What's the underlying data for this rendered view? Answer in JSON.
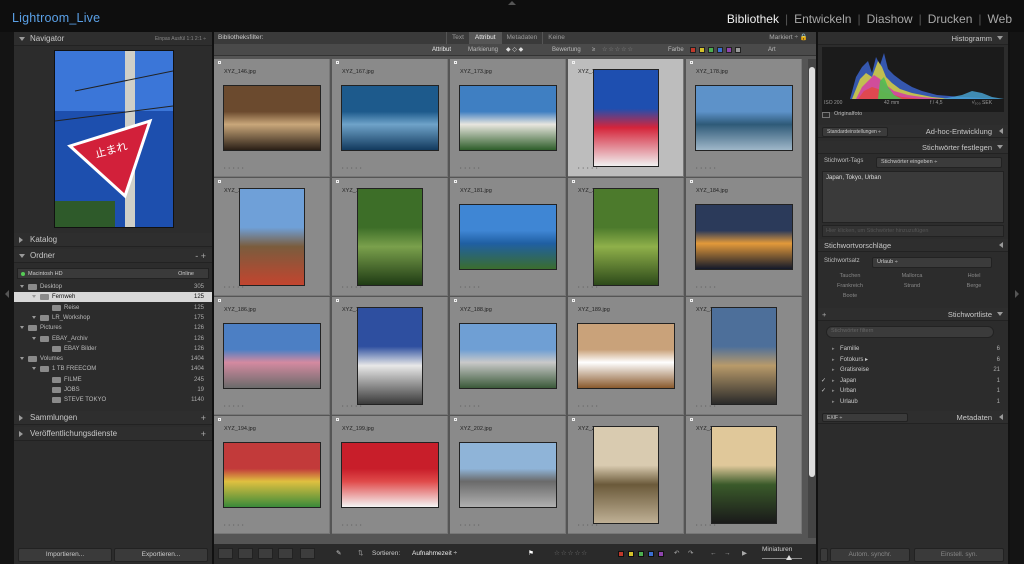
{
  "app": {
    "title": "Lightroom_Live",
    "modules": [
      {
        "label": "Bibliothek",
        "active": true
      },
      {
        "label": "Entwickeln",
        "active": false
      },
      {
        "label": "Diashow",
        "active": false
      },
      {
        "label": "Drucken",
        "active": false
      },
      {
        "label": "Web",
        "active": false
      }
    ]
  },
  "left_panel": {
    "navigator": {
      "title": "Navigator",
      "opts": "Einpas  Ausfül  1:1  2:1 ÷"
    },
    "catalog": {
      "title": "Katalog"
    },
    "folders": {
      "title": "Ordner",
      "plus": "-  +",
      "disk": {
        "name": "Macintosh HD",
        "status": "Online"
      },
      "rows": [
        {
          "name": "Desktop",
          "count": "305",
          "level": 1,
          "selected": false
        },
        {
          "name": "Fernweh",
          "count": "125",
          "level": 2,
          "selected": true
        },
        {
          "name": "Reise",
          "count": "125",
          "level": 3,
          "selected": false
        },
        {
          "name": "LR_Workshop",
          "count": "175",
          "level": 2,
          "selected": false
        },
        {
          "name": "Pictures",
          "count": "126",
          "level": 1,
          "selected": false
        },
        {
          "name": "EBAY_Archiv",
          "count": "126",
          "level": 2,
          "selected": false
        },
        {
          "name": "EBAY Bilder",
          "count": "126",
          "level": 3,
          "selected": false
        },
        {
          "name": "Volumes",
          "count": "1404",
          "level": 1,
          "selected": false
        },
        {
          "name": "1 TB FREECOM",
          "count": "1404",
          "level": 2,
          "selected": false
        },
        {
          "name": "FILME",
          "count": "245",
          "level": 3,
          "selected": false
        },
        {
          "name": "JOBS",
          "count": "19",
          "level": 3,
          "selected": false
        },
        {
          "name": "STEVE TOKYO",
          "count": "1140",
          "level": 3,
          "selected": false
        }
      ]
    },
    "collections": {
      "title": "Sammlungen",
      "plus": "+"
    },
    "publish": {
      "title": "Veröffentlichungsdienste",
      "plus": "+"
    },
    "import_label": "Importieren...",
    "export_label": "Exportieren..."
  },
  "filter_bar": {
    "title": "Bibliotheksfilter:",
    "tabs": [
      {
        "label": "Text",
        "active": false
      },
      {
        "label": "Attribut",
        "active": true
      },
      {
        "label": "Metadaten",
        "active": false
      },
      {
        "label": "Keine",
        "active": false
      }
    ],
    "preset": "Markiert ÷  🔒",
    "attr_label": "Attribut",
    "markierung": "Markierung",
    "bewertung": "Bewertung",
    "bewertung_op": "≥",
    "farbe": "Farbe",
    "art": "Art",
    "colors": [
      "#c0392b",
      "#d4c12a",
      "#4caf50",
      "#3b6fd0",
      "#8e44ad",
      "#999999"
    ]
  },
  "grid": {
    "cells": [
      {
        "file": "XYZ_146.jpg",
        "colors": [
          "#6b4a2e",
          "#c9a77a",
          "#2a1f16"
        ],
        "orient": "land"
      },
      {
        "file": "XYZ_167.jpg",
        "colors": [
          "#1d5a8c",
          "#6fa3c9",
          "#123a5e"
        ],
        "orient": "land"
      },
      {
        "file": "XYZ_173.jpg",
        "colors": [
          "#3f7fc2",
          "#e8e6df",
          "#2e5e2a"
        ],
        "orient": "land"
      },
      {
        "file": "XYZ_177.jpg",
        "colors": [
          "#1e4fb0",
          "#d5243a",
          "#f0f0f0"
        ],
        "orient": "port",
        "selected": true
      },
      {
        "file": "XYZ_178.jpg",
        "colors": [
          "#5d92c9",
          "#2e5a78",
          "#9fb7c9"
        ],
        "orient": "land"
      },
      {
        "file": "XYZ_179.jpg",
        "colors": [
          "#6fa0d8",
          "#7a5c3d",
          "#c3452f"
        ],
        "orient": "port"
      },
      {
        "file": "XYZ_180.jpg",
        "colors": [
          "#3d6e28",
          "#7aa04c",
          "#1f3b14"
        ],
        "orient": "port"
      },
      {
        "file": "XYZ_181.jpg",
        "colors": [
          "#3f86d4",
          "#1f5fa3",
          "#3b6d2e"
        ],
        "orient": "land"
      },
      {
        "file": "XYZ_183.jpg",
        "colors": [
          "#4c7a2c",
          "#8fb04a",
          "#2d4a1a"
        ],
        "orient": "port"
      },
      {
        "file": "XYZ_184.jpg",
        "colors": [
          "#2b3a5a",
          "#e39a3a",
          "#141a2a"
        ],
        "orient": "land"
      },
      {
        "file": "XYZ_186.jpg",
        "colors": [
          "#4c7fc4",
          "#d48aa0",
          "#6b6b6b"
        ],
        "orient": "land"
      },
      {
        "file": "XYZ_187.jpg",
        "colors": [
          "#2e4fa0",
          "#e8e8e8",
          "#3a3a3a"
        ],
        "orient": "port"
      },
      {
        "file": "XYZ_188.jpg",
        "colors": [
          "#6f9fd4",
          "#c9c9c9",
          "#3b5a3a"
        ],
        "orient": "land"
      },
      {
        "file": "XYZ_189.jpg",
        "colors": [
          "#c9a27a",
          "#ffffff",
          "#8a5a2e"
        ],
        "orient": "land"
      },
      {
        "file": "XYZ_191.jpg",
        "colors": [
          "#4d6f9a",
          "#b89a6a",
          "#2a2a2a"
        ],
        "orient": "port"
      },
      {
        "file": "XYZ_194.jpg",
        "colors": [
          "#c23a3a",
          "#e0c040",
          "#3a8a3a"
        ],
        "orient": "land"
      },
      {
        "file": "XYZ_199.jpg",
        "colors": [
          "#c81e2a",
          "#e04a4a",
          "#f5f5f5"
        ],
        "orient": "land"
      },
      {
        "file": "XYZ_202.jpg",
        "colors": [
          "#8fb4d8",
          "#6a6a6a",
          "#b0b0b0"
        ],
        "orient": "land"
      },
      {
        "file": "XYZ_205.jpg",
        "colors": [
          "#d9cbb0",
          "#6b5a3a",
          "#bfb095"
        ],
        "orient": "port"
      },
      {
        "file": "XYZ_213.jpg",
        "colors": [
          "#e0c89a",
          "#3a5a2a",
          "#1a1a1a"
        ],
        "orient": "port"
      }
    ],
    "stars": "• • • • •"
  },
  "toolbar": {
    "sort_label": "Sortieren:",
    "sort_value": "Aufnahmezeit ÷",
    "thumb_label": "Miniaturen",
    "tag_colors": [
      "#c0392b",
      "#d4c12a",
      "#4caf50",
      "#3b6fd0",
      "#8e44ad"
    ]
  },
  "right_panel": {
    "histogram": {
      "title": "Histogramm",
      "iso": "ISO 200",
      "focal": "42 mm",
      "aperture": "f / 4,5",
      "shutter": "¹⁄₅₀₀ SEK",
      "original": "Originalfoto"
    },
    "quick_develop": {
      "title": "Ad-hoc-Entwicklung",
      "preset": "Standardeinstellungen ÷"
    },
    "keywording": {
      "title": "Stichwörter festlegen",
      "tags_label": "Stichwort-Tags",
      "tags_select": "Stichwörter eingeben ÷",
      "tags_value": "Japan, Tokyo, Urban",
      "input_placeholder": "Hier klicken, um Stichwörter hinzuzufügen"
    },
    "suggestions": {
      "title": "Stichwortvorschläge"
    },
    "keyword_set": {
      "label": "Stichwortsatz",
      "value": "Urlaub ÷",
      "items": [
        "Tauchen",
        "Mallorca",
        "Hotel",
        "Frankreich",
        "Strand",
        "Berge",
        "Boote",
        "",
        ""
      ]
    },
    "keyword_list": {
      "title": "Stichwortliste",
      "search_placeholder": "Stichwörter filtern",
      "rows": [
        {
          "name": "Familie",
          "count": "6",
          "checked": false
        },
        {
          "name": "Fotokurs ▸",
          "count": "6",
          "checked": false
        },
        {
          "name": "Gratisreise",
          "count": "21",
          "checked": false
        },
        {
          "name": "Japan",
          "count": "1",
          "checked": true
        },
        {
          "name": "Urban",
          "count": "1",
          "checked": true
        },
        {
          "name": "Urlaub",
          "count": "1",
          "checked": false
        }
      ]
    },
    "metadata": {
      "title": "Metadaten",
      "preset": "EXIF ÷"
    },
    "sync_meta": "Autom. synchr.",
    "sync_settings": "Einstell. syn."
  }
}
